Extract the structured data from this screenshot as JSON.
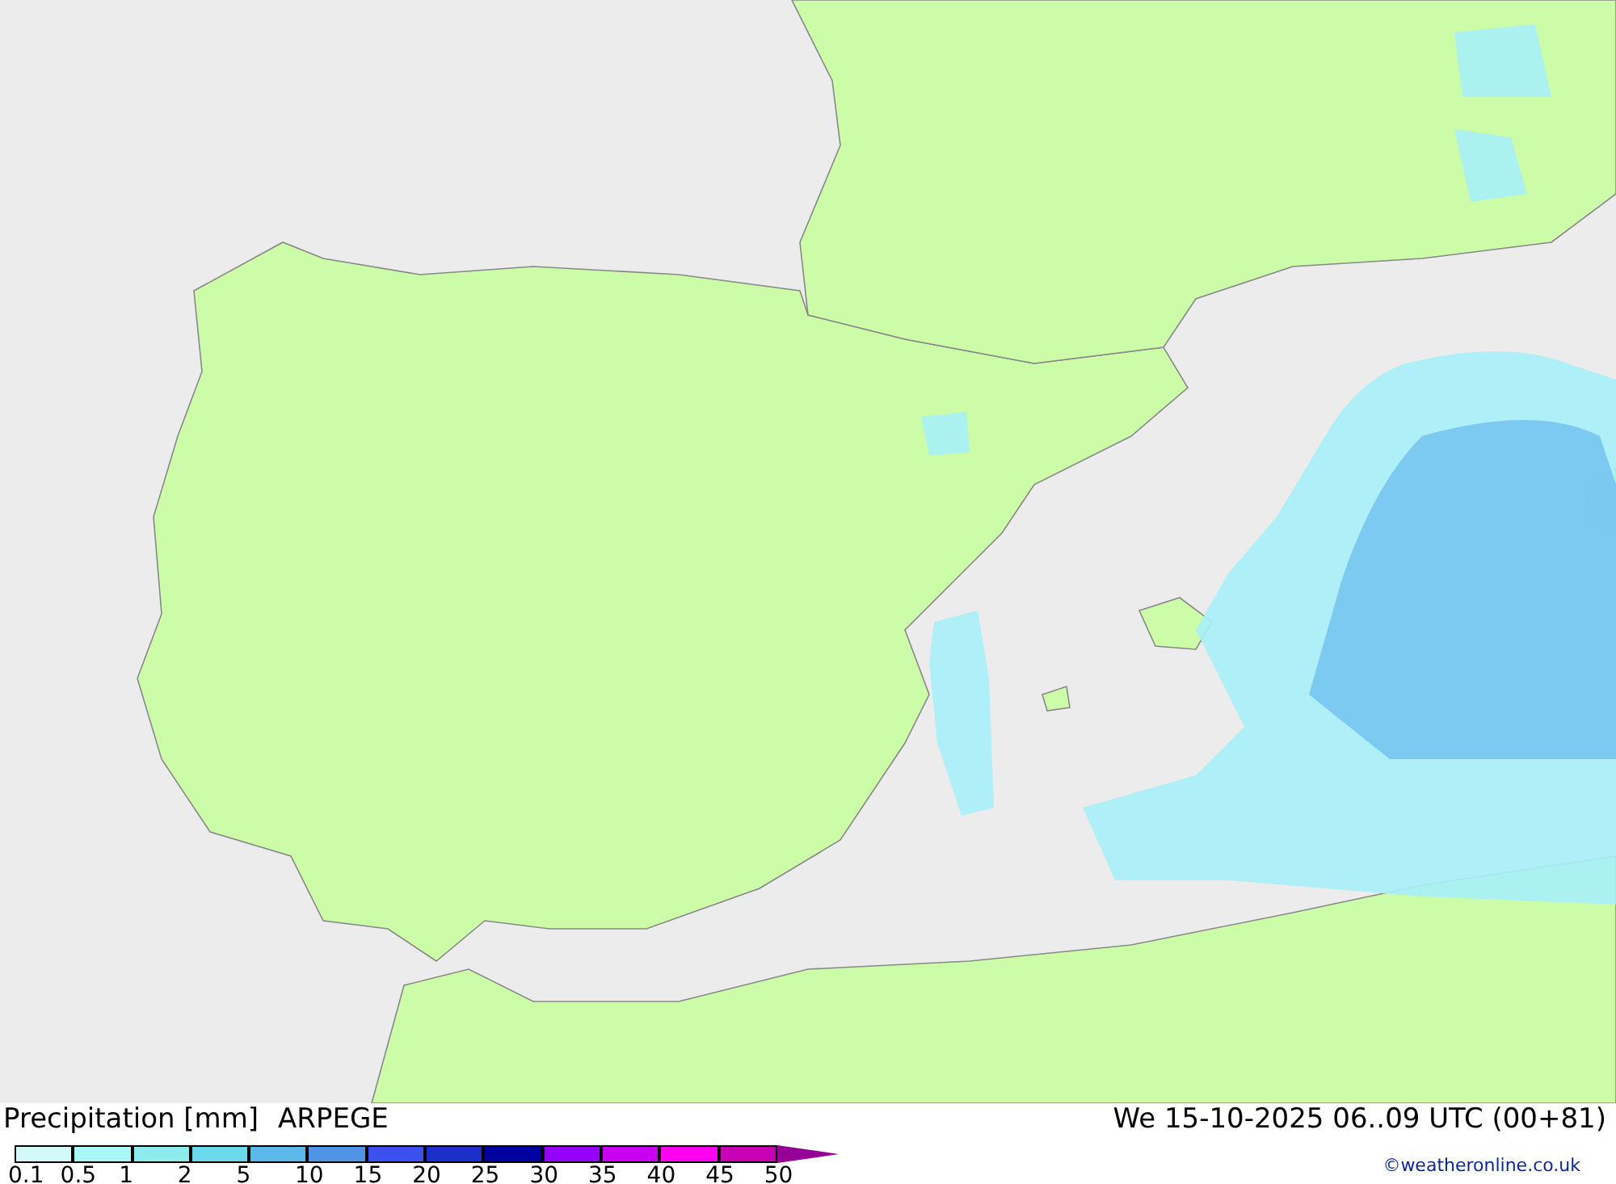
{
  "map": {
    "title": "Precipitation [mm]",
    "model": "ARPEGE",
    "valid_time": "We 15-10-2025 06..09 UTC (00+81)",
    "copyright": "©weatheronline.co.uk"
  },
  "legend": {
    "bins": [
      {
        "color": "#d2f8f8"
      },
      {
        "color": "#a8f8f8"
      },
      {
        "color": "#8ceceb"
      },
      {
        "color": "#6ad9ea"
      },
      {
        "color": "#5ab8ea"
      },
      {
        "color": "#5094e6"
      },
      {
        "color": "#3c50f0"
      },
      {
        "color": "#1e2ec8"
      },
      {
        "color": "#0000a0"
      },
      {
        "color": "#9600ff"
      },
      {
        "color": "#c800f0"
      },
      {
        "color": "#ff00f0"
      },
      {
        "color": "#c800b4"
      }
    ],
    "labels": [
      "0.1",
      "0.5",
      "1",
      "2",
      "5",
      "10",
      "15",
      "20",
      "25",
      "30",
      "35",
      "40",
      "45",
      "50"
    ]
  }
}
